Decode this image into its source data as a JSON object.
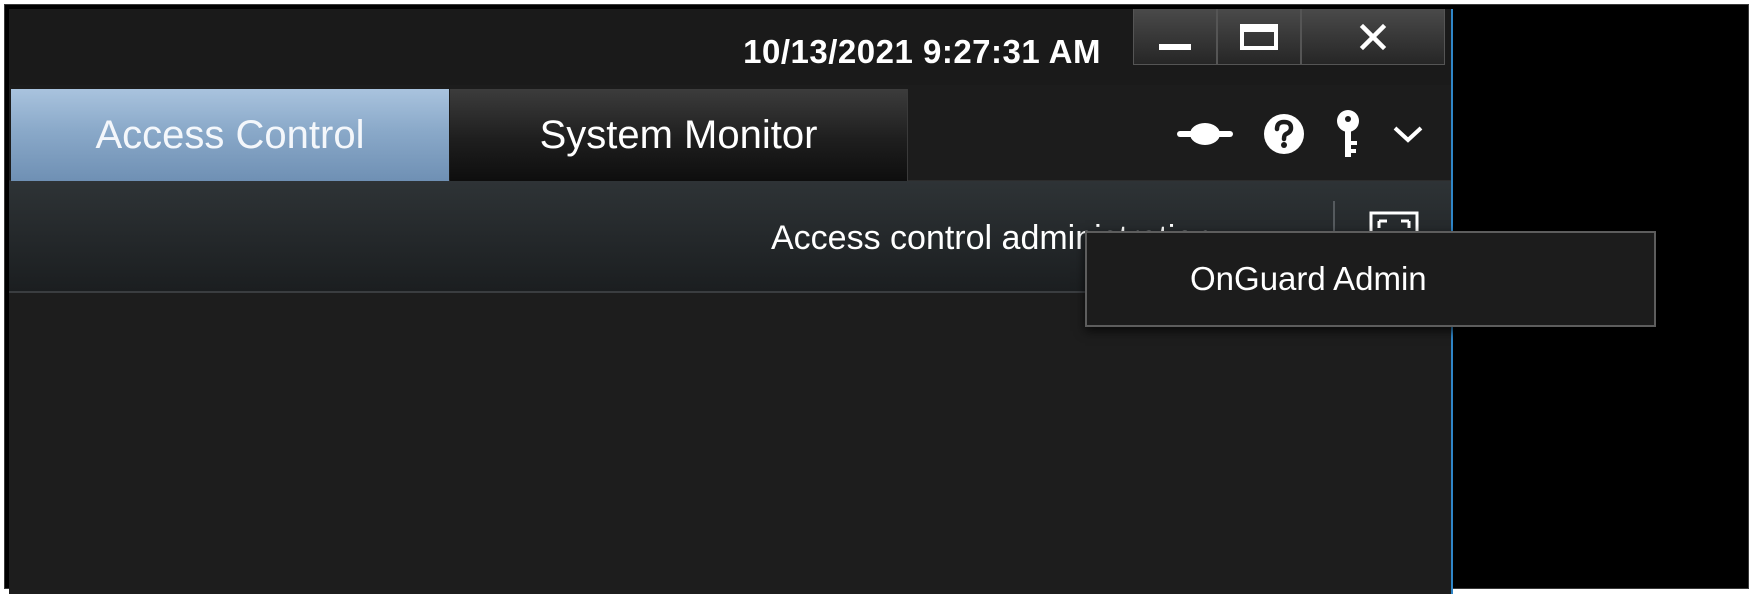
{
  "titlebar": {
    "datetime": "10/13/2021 9:27:31 AM",
    "window_controls": [
      "minimize-icon",
      "maximize-icon",
      "close-icon"
    ]
  },
  "tabs": [
    {
      "label": "Access Control",
      "active": true
    },
    {
      "label": "System Monitor",
      "active": false
    }
  ],
  "tab_icons": [
    "connection-icon",
    "help-icon",
    "key-icon",
    "chevron-down-icon"
  ],
  "toolbar": {
    "label": "Access control administration",
    "expand_icon": "expand-icon"
  },
  "dropdown": {
    "items": [
      {
        "label": "OnGuard Admin"
      }
    ]
  },
  "colors": {
    "active_tab": "#8aa9c9",
    "background": "#1d1d1d",
    "accent_border": "#2f86c8"
  }
}
